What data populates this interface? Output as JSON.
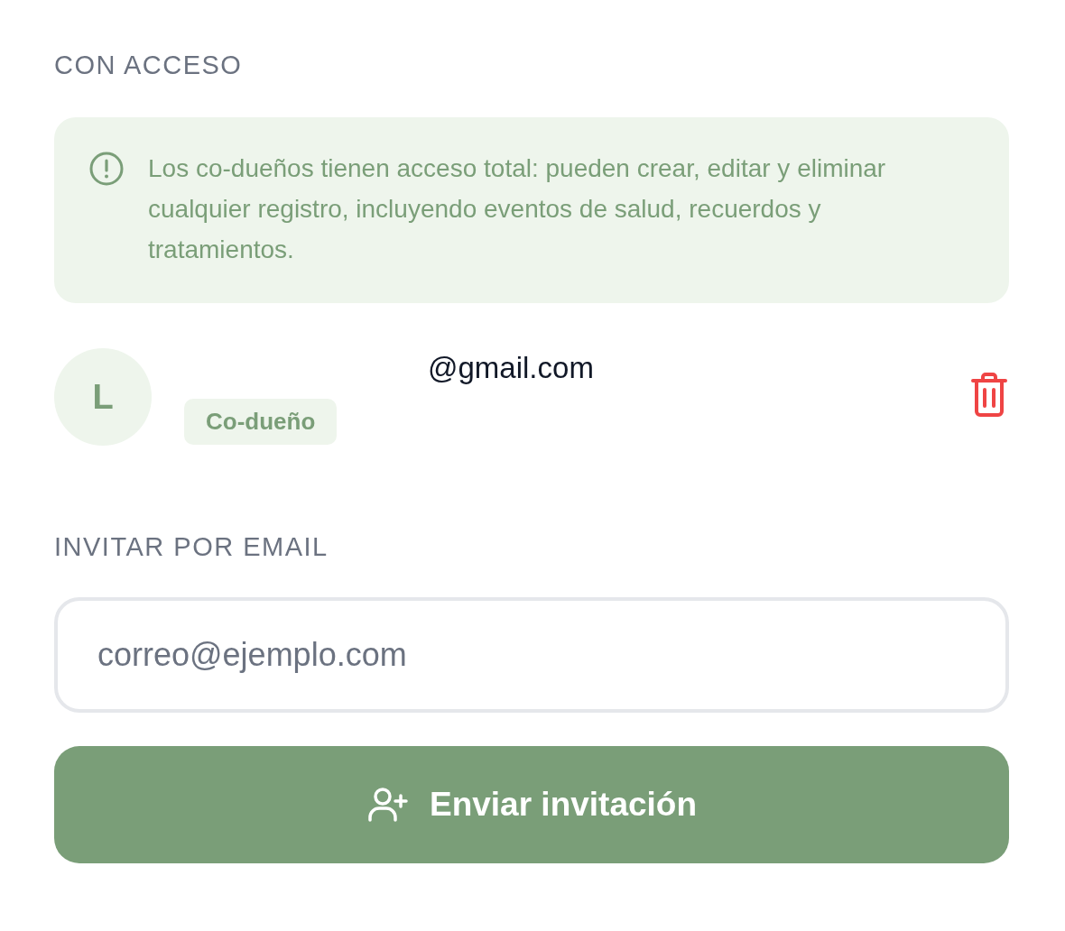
{
  "access_section": {
    "heading": "CON ACCESO",
    "notice": "Los co-dueños tienen acceso total: pueden crear, editar y eliminar cualquier registro, incluyendo eventos de salud, recuerdos y tratamientos.",
    "members": [
      {
        "initial": "L",
        "email": "@gmail.com",
        "role": "Co-dueño"
      }
    ]
  },
  "invite_section": {
    "heading": "INVITAR POR EMAIL",
    "email_field": {
      "placeholder": "correo@ejemplo.com"
    },
    "submit_button": "Enviar invitación"
  }
}
